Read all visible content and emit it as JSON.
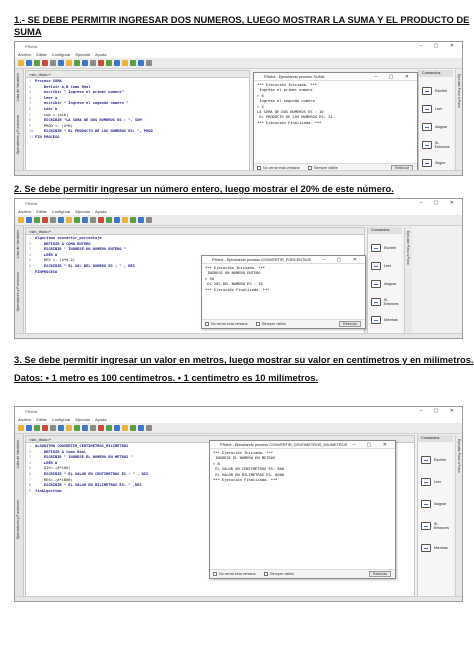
{
  "sections": [
    {
      "heading_1": "1.- SE DEBE PERMITIR INGRESAR DOS NUMEROS, LUEGO MOSTRAR LA SUMA Y EL PRODUCTO DE",
      "heading_2": "SUMA",
      "window_title": "PSeInt",
      "menu": [
        "Archivo",
        "Editar",
        "Configurar",
        "Ejecutar",
        "Ayuda"
      ],
      "sidebar_label_1": "Lista de Variables",
      "sidebar_label_2": "Operadores y Funciones",
      "tab_label": "<sin_titulo>*",
      "code": [
        {
          "n": "1",
          "t": "Proceso SUMA"
        },
        {
          "n": "2",
          "t": "    Definir A,B Como Real"
        },
        {
          "n": "3",
          "t": "    escribir \" Ingrese el primer numero\""
        },
        {
          "n": "4",
          "t": "    Leer a"
        },
        {
          "n": "5",
          "t": "    escribir \" Ingrese el segundo numero \""
        },
        {
          "n": "6",
          "t": "    Leer b"
        },
        {
          "n": "7",
          "t": "    sum <-(a+b)"
        },
        {
          "n": "8",
          "t": "    ESCRIBIR \"LA SUMA DE DOS NUMEROS ES : \", SUM"
        },
        {
          "n": "9",
          "t": "    PROD <- (A*B)"
        },
        {
          "n": "10",
          "t": "    ESCRIBIR \" EL PRODUCTO DE LOS NUMEROS ES: \", PROD"
        },
        {
          "n": "11",
          "t": "FIN PROCESO"
        }
      ],
      "run_title": "PSeInt - Ejecutando proceso SUMA",
      "output": [
        "*** Ejecución Iniciada. ***",
        " Ingrese el primer numero",
        "> 6",
        " Ingrese el segundo numero",
        "> 4",
        "LA SUMA DE DOS NUMEROS ES : 10",
        " EL PRODUCTO DE LOS NUMEROS ES: 24",
        "*** Ejecución Finalizada. ***"
      ],
      "footer_checkbox_1": "No cerrar esta ventana",
      "footer_checkbox_2": "Siempre visible",
      "footer_button": "Reiniciar",
      "commands_title": "Comandos",
      "commands": [
        "Escribir",
        "Leer",
        "Asignar",
        "Si-Entonces",
        "Según"
      ],
      "right_strip": "Ejecutar Paso a Paso"
    },
    {
      "heading_1": "2. Se debe permitir ingresar un número entero, luego mostrar el 20% de este número.",
      "window_title": "PSeInt",
      "menu": [
        "Archivo",
        "Editar",
        "Configurar",
        "Ejecutar",
        "Ayuda"
      ],
      "sidebar_label_1": "Lista de Variables",
      "sidebar_label_2": "Operadores y Funciones",
      "tab_label": "<sin_titulo>*",
      "code": [
        {
          "n": "1",
          "t": "Algoritmo convertir_porcentaje"
        },
        {
          "n": "2",
          "t": "    DEFINIR A COMO ENTERO"
        },
        {
          "n": "3",
          "t": "    ESCRIBIR \" INGRESE UN NUMERO ENTERO \""
        },
        {
          "n": "4",
          "t": "    LEER A"
        },
        {
          "n": "5",
          "t": "    RES <- (A*0.2)"
        },
        {
          "n": "6",
          "t": "    ESCRIBIR \" EL 20% DEL NUMERO ES : \" , RES"
        },
        {
          "n": "7",
          "t": "FINPROCESO"
        }
      ],
      "run_title": "PSeInt - Ejecutando proceso CONVERTIR_PORCENTAJE",
      "output": [
        "*** Ejecución Iniciada. ***",
        " INGRESE UN NUMERO ENTERO",
        "> 50",
        " EL 20% DEL NUMERO ES : 10",
        "*** Ejecución Finalizada. ***"
      ],
      "footer_checkbox_1": "No cerrar esta ventana",
      "footer_checkbox_2": "Siempre visible",
      "footer_button": "Reiniciar",
      "commands_title": "Comandos",
      "commands": [
        "Escribir",
        "Leer",
        "Asignar",
        "Si-Entonces",
        "Mientras"
      ],
      "right_strip": "Ejecutar Paso a Paso"
    },
    {
      "heading_1": "3. Se debe permitir ingresar un valor en metros, luego mostrar su valor en centímetros y en milímetros.",
      "heading_2": "Datos: • 1 metro es 100 centímetros. • 1 centímetro es 10 milímetros.",
      "window_title": "PSeInt",
      "menu": [
        "Archivo",
        "Editar",
        "Configurar",
        "Ejecutar",
        "Ayuda"
      ],
      "sidebar_label_1": "Lista de Variables",
      "sidebar_label_2": "Operadores y Funciones",
      "tab_label": "<sin_titulo>*",
      "code": [
        {
          "n": "1",
          "t": "ALGORITMO CONVERTIR_CENTIMETROS_MILIMETROS"
        },
        {
          "n": "2",
          "t": "    DEFINIR A Como Real"
        },
        {
          "n": "3",
          "t": "    ESCRIBIR \" INGRESE EL NUMERO EN METROS \""
        },
        {
          "n": "4",
          "t": "    LEER A"
        },
        {
          "n": "5",
          "t": "    DIV<-(A*100)"
        },
        {
          "n": "6",
          "t": "    ESCRIBIR \" EL VALOR EN CENTIMETROS ES : \" , DIV"
        },
        {
          "n": "7",
          "t": "    RES<-(A*1000)"
        },
        {
          "n": "8",
          "t": "    ESCRIBIR \" EL VALOR EN MILIMETROS ES: \" ,RES"
        },
        {
          "n": "9",
          "t": "finAlgoritmo"
        }
      ],
      "run_title": "PSeInt - Ejecutando proceso CONVERTIR_CENTIMETROS_MILIMETROS",
      "output": [
        "*** Ejecución Iniciada. ***",
        " INGRESE EL NUMERO EN METROS",
        "> 8",
        " EL VALOR EN CENTIMETROS ES: 800",
        " EL VALOR EN MILIMETROS ES: 8000",
        "*** Ejecución Finalizada. ***"
      ],
      "footer_checkbox_1": "No cerrar esta ventana",
      "footer_checkbox_2": "Siempre visible",
      "footer_button": "Reiniciar",
      "commands_title": "Comandos",
      "commands": [
        "Escribir",
        "Leer",
        "Asignar",
        "Si-Entonces",
        "Mientras"
      ],
      "right_strip": "Ejecutar Paso a Paso"
    }
  ],
  "toolbar_colors": [
    "#e8b23c",
    "#3b78c8",
    "#5aa040",
    "#c94a3a",
    "#8a8a8a",
    "#3b78c8",
    "#e8b23c",
    "#5aa040",
    "#3b78c8",
    "#8a8a8a",
    "#c94a3a",
    "#5aa040",
    "#3b78c8",
    "#e8b23c",
    "#5aa040",
    "#3b78c8",
    "#8a8a8a"
  ]
}
